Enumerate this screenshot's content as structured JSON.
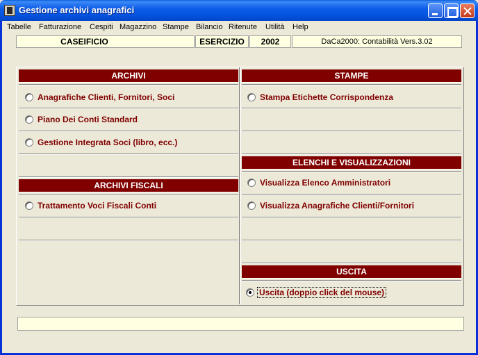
{
  "window": {
    "title": "Gestione archivi anagrafici"
  },
  "menu": [
    {
      "label": "Tabelle"
    },
    {
      "label": "Fatturazione"
    },
    {
      "label": "Cespiti"
    },
    {
      "label": "Magazzino"
    },
    {
      "label": "Stampe"
    },
    {
      "label": "Bilancio"
    },
    {
      "label": "Ritenute"
    },
    {
      "label": "Utilità"
    },
    {
      "label": "Help"
    }
  ],
  "info": {
    "company": "CASEIFICIO",
    "year_label": "ESERCIZIO",
    "year": "2002",
    "app_version": "DaCa2000: Contabilità Vers.3.02"
  },
  "archivi": {
    "header": "ARCHIVI",
    "options": [
      {
        "label": "Anagrafiche Clienti, Fornitori, Soci",
        "selected": false
      },
      {
        "label": "Piano Dei Conti Standard",
        "selected": false
      },
      {
        "label": "Gestione Integrata Soci (libro, ecc.)",
        "selected": false
      }
    ]
  },
  "archivi_fiscali": {
    "header": "ARCHIVI FISCALI",
    "options": [
      {
        "label": "Trattamento Voci Fiscali Conti",
        "selected": false
      }
    ]
  },
  "stampe": {
    "header": "STAMPE",
    "options": [
      {
        "label": "Stampa Etichette Corrispondenza",
        "selected": false
      }
    ]
  },
  "elenchi": {
    "header": "ELENCHI E VISUALIZZAZIONI",
    "options": [
      {
        "label": "Visualizza Elenco Amministratori",
        "selected": false
      },
      {
        "label": "Visualizza Anagrafiche Clienti/Fornitori",
        "selected": false
      }
    ]
  },
  "uscita": {
    "header": "USCITA",
    "options": [
      {
        "label": "Uscita (doppio click del mouse)",
        "selected": true
      }
    ]
  },
  "statusbar": {
    "text": ""
  },
  "colors": {
    "header_bg": "#800000",
    "option_text": "#800000",
    "info_bg": "#ffffe1",
    "window_bg": "#ece9d8",
    "titlebar": "#0454e0"
  }
}
